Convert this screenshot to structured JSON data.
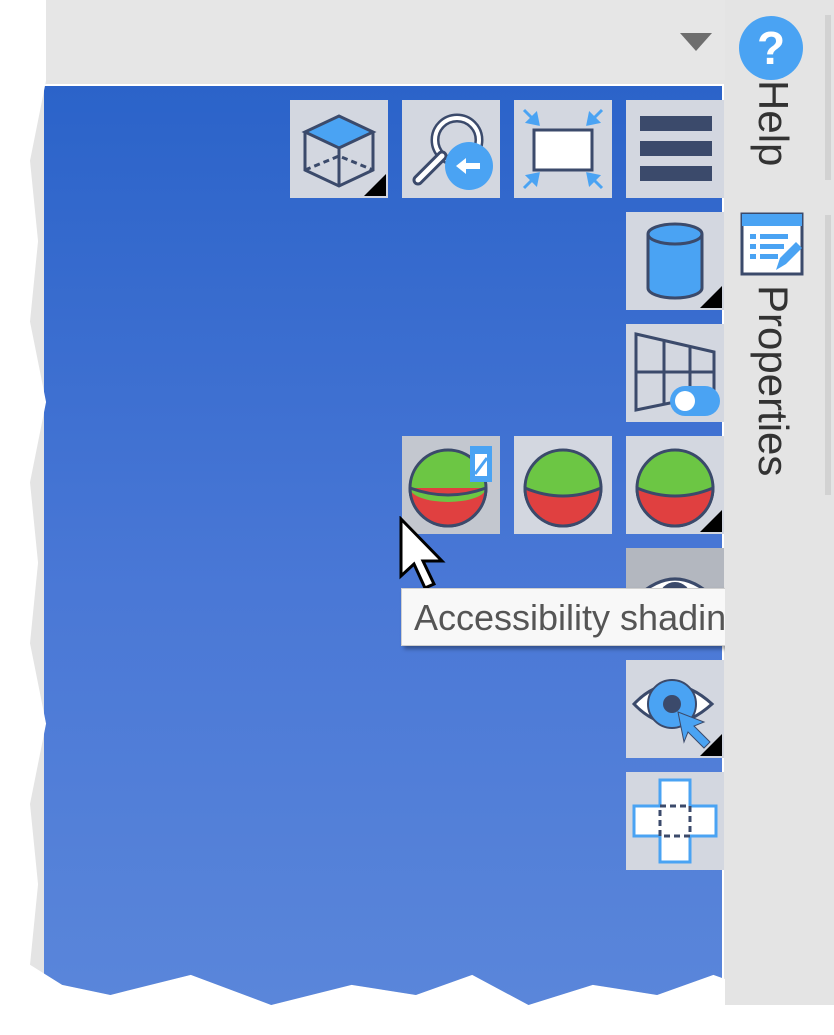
{
  "toolbar": {
    "row1": [
      {
        "id": "view-cube",
        "icon": "cube-icon",
        "has_menu": true
      },
      {
        "id": "zoom-previous",
        "icon": "zoom-previous-icon",
        "has_menu": false
      },
      {
        "id": "zoom-extents",
        "icon": "zoom-extents-icon",
        "has_menu": false
      },
      {
        "id": "menu",
        "icon": "hamburger-menu-icon",
        "has_menu": false
      }
    ],
    "column": [
      {
        "id": "display-objects",
        "icon": "cylinder-icon",
        "has_menu": true
      },
      {
        "id": "grid-toggle",
        "icon": "grid-toggle-icon",
        "has_menu": false
      }
    ],
    "shading_row": [
      {
        "id": "accessibility-shading",
        "icon": "accessibility-shading-icon",
        "has_menu": false,
        "state": "hover"
      },
      {
        "id": "shading",
        "icon": "shaded-sphere-icon",
        "has_menu": false
      },
      {
        "id": "shading-options",
        "icon": "shaded-sphere-icon",
        "has_menu": true
      }
    ],
    "column2": [
      {
        "id": "visibility",
        "icon": "eye-icon",
        "has_menu": false,
        "state": "pressed"
      },
      {
        "id": "visibility-select",
        "icon": "eye-pointer-icon",
        "has_menu": true
      },
      {
        "id": "section-box",
        "icon": "section-box-icon",
        "has_menu": false
      }
    ]
  },
  "tooltip": {
    "text": "Accessibility shading"
  },
  "sidebar": {
    "tabs": [
      {
        "label": "Help",
        "icon": "help-icon"
      },
      {
        "label": "Properties",
        "icon": "properties-icon"
      }
    ],
    "help_glyph": "?"
  },
  "colors": {
    "viewport_top": "#2b63c9",
    "viewport_bottom": "#5a86da",
    "button_bg": "#d3d7e0",
    "accent_blue": "#4aa3f3",
    "icon_stroke": "#3b4a6b",
    "sphere_green": "#6cc644",
    "sphere_red": "#e04040"
  }
}
